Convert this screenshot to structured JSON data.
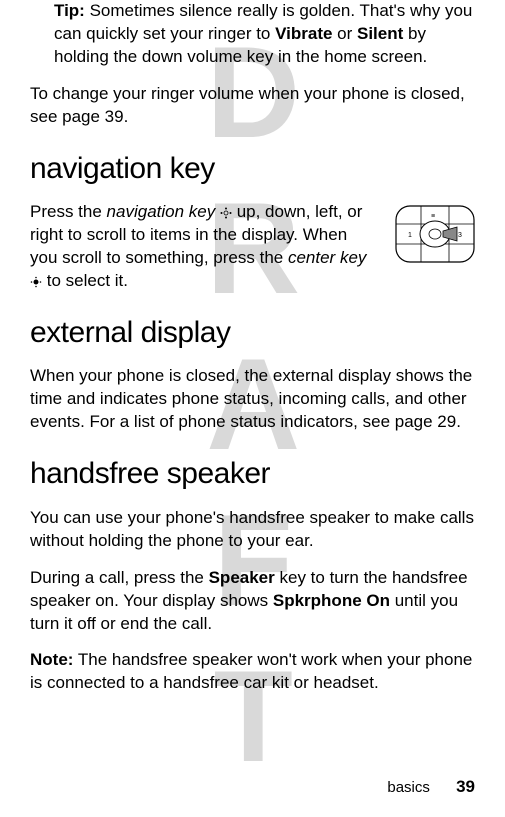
{
  "watermark": "DRAFT",
  "tip": {
    "label": "Tip:",
    "before_vibrate": " Sometimes silence really is golden. That's why you can quickly set your ringer to ",
    "vibrate": "Vibrate",
    "between": " or ",
    "silent": "Silent",
    "after_silent": " by holding the down volume key in the home screen."
  },
  "ringer_para": "To change your ringer volume when your phone is closed, see page 39.",
  "nav": {
    "heading": "navigation key",
    "before_navkey": "Press the ",
    "navkey": "navigation key",
    "navglyph": " ",
    "after_navglyph": " up, down, left, or right to scroll to items in the display. When you scroll to something, press the ",
    "centerkey": "center key",
    "centerglyph": " ",
    "after_center": " to select it."
  },
  "external": {
    "heading": "external display",
    "para": "When your phone is closed, the external display shows the time and indicates phone status, incoming calls, and other events. For a list of phone status indicators, see page 29."
  },
  "handsfree": {
    "heading": "handsfree speaker",
    "para1": "You can use your phone's handsfree speaker to make calls without holding the phone to your ear.",
    "para2_before": "During a call, press the ",
    "speaker": "Speaker",
    "para2_mid": " key to turn the handsfree speaker on. Your display shows ",
    "spkrphone": "Spkrphone On",
    "para2_after": " until you turn it off or end the call.",
    "note_label": "Note:",
    "note_text": " The handsfree speaker won't work when your phone is connected to a handsfree car kit or headset."
  },
  "footer": {
    "section": "basics",
    "page": "39"
  }
}
